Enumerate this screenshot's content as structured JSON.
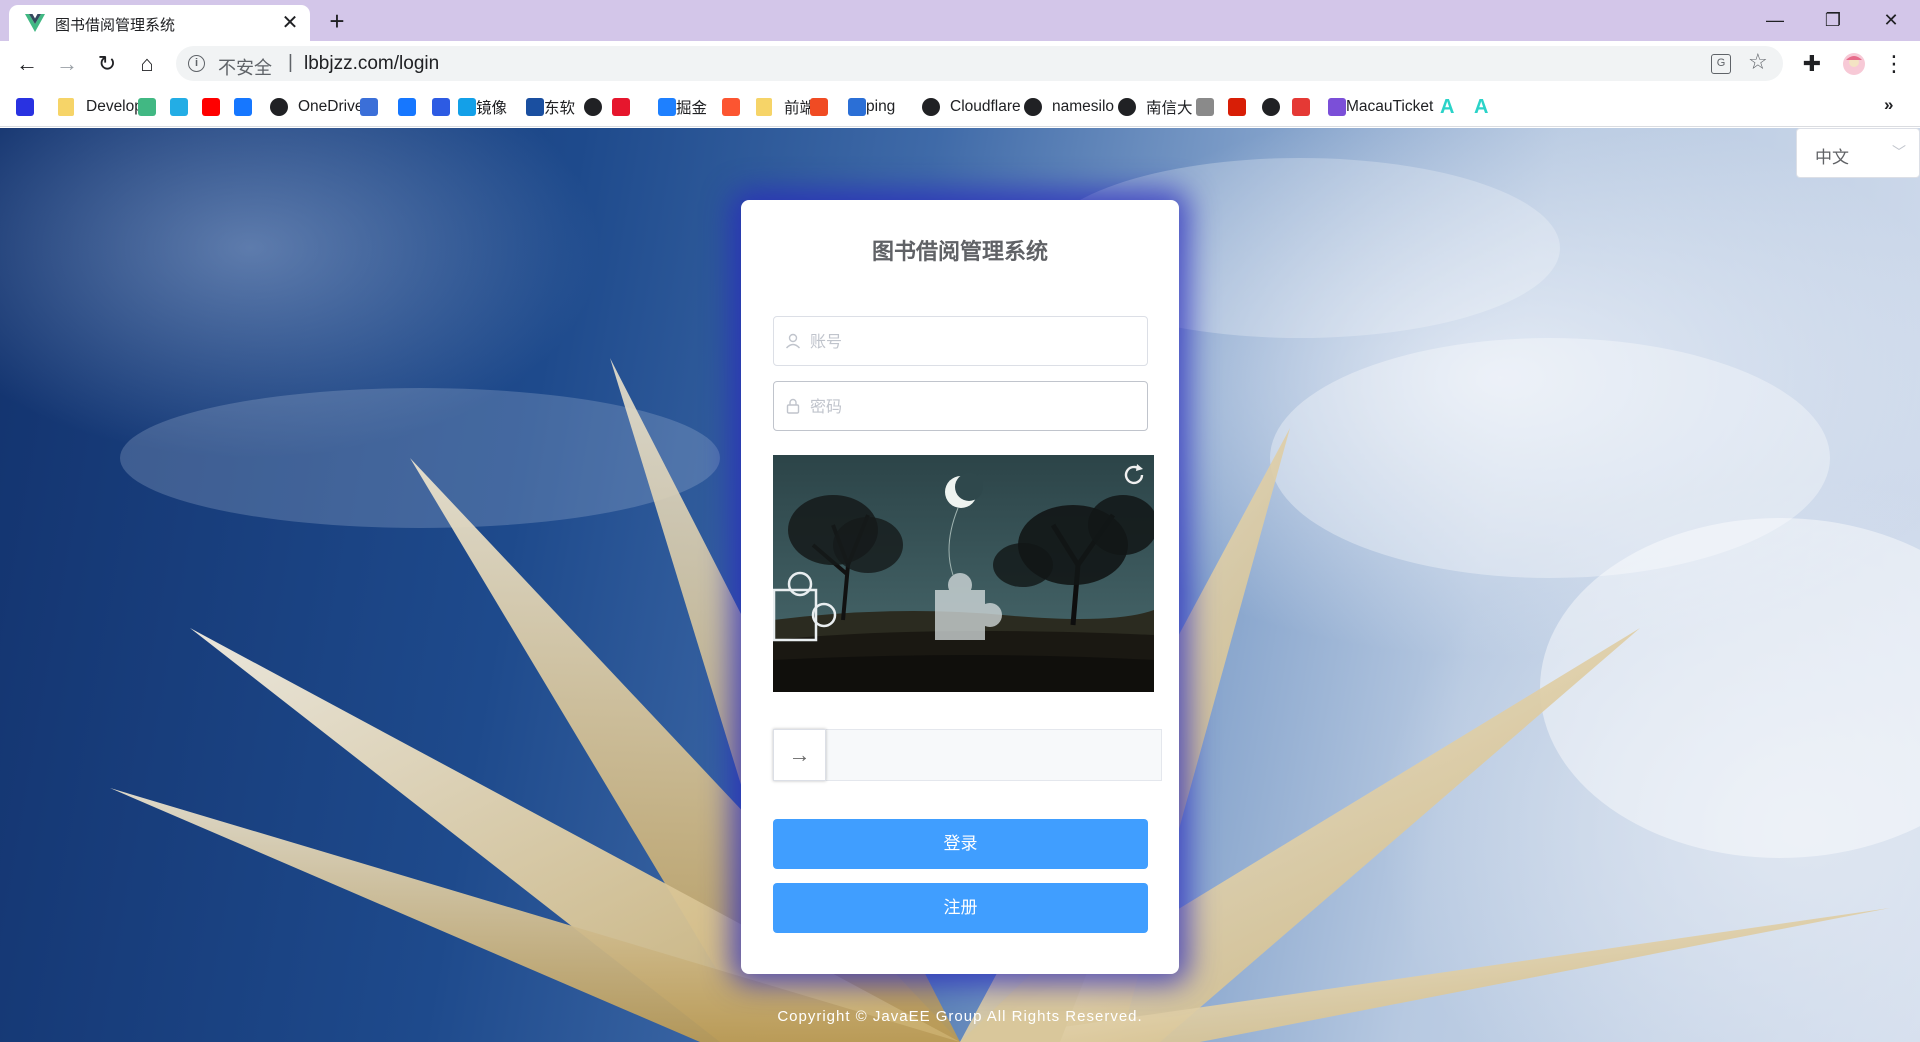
{
  "browser": {
    "tab_title": "图书借阅管理系统",
    "tab_close": "✕",
    "new_tab": "+",
    "window_controls": {
      "minimize": "—",
      "maximize": "❐",
      "close": "✕"
    }
  },
  "toolbar": {
    "back": "←",
    "forward": "→",
    "reload": "↻",
    "home": "⌂",
    "security_label": "不安全",
    "separator": "|",
    "url": "lbbjzz.com/login",
    "menu": "⋮",
    "extensions": "✚"
  },
  "bookmarks": [
    {
      "label": "",
      "icon": "baidu-paw",
      "color": "#2932e1"
    },
    {
      "label": "Develop",
      "icon": "folder",
      "color": "#f6d468"
    },
    {
      "label": "",
      "icon": "vue-v",
      "color": "#41b883"
    },
    {
      "label": "",
      "icon": "bilibili-tv",
      "color": "#23ade5"
    },
    {
      "label": "",
      "icon": "youtube-play",
      "color": "#ff0000"
    },
    {
      "label": "",
      "icon": "cloud-link",
      "color": "#1677ff"
    },
    {
      "label": "OneDrive",
      "icon": "globe",
      "color": "#202124"
    },
    {
      "label": "",
      "icon": "card",
      "color": "#3b6fd8"
    },
    {
      "label": "",
      "icon": "cloud",
      "color": "#1677ff"
    },
    {
      "label": "",
      "icon": "bowtie",
      "color": "#2d5be3"
    },
    {
      "label": "镜像",
      "icon": "bird",
      "color": "#13a0e8"
    },
    {
      "label": "东软",
      "icon": "dash",
      "color": "#1a4fa0"
    },
    {
      "label": "",
      "icon": "github",
      "color": "#202124"
    },
    {
      "label": "",
      "icon": "weibo-ring",
      "color": "#e6162d"
    },
    {
      "label": "掘金",
      "icon": "juejin",
      "color": "#1e80ff"
    },
    {
      "label": "",
      "icon": "csdn-c",
      "color": "#fc5531"
    },
    {
      "label": "前端",
      "icon": "folder",
      "color": "#f6d468"
    },
    {
      "label": "",
      "icon": "red-square",
      "color": "#f04b23"
    },
    {
      "label": "ping",
      "icon": "ping",
      "color": "#2b6fd6"
    },
    {
      "label": "Cloudflare",
      "icon": "globe",
      "color": "#202124"
    },
    {
      "label": "namesilo",
      "icon": "globe",
      "color": "#202124"
    },
    {
      "label": "南信大",
      "icon": "globe",
      "color": "#202124"
    },
    {
      "label": "",
      "icon": "apple",
      "color": "#8a8a8a"
    },
    {
      "label": "",
      "icon": "seal",
      "color": "#d81e06"
    },
    {
      "label": "",
      "icon": "globe",
      "color": "#202124"
    },
    {
      "label": "",
      "icon": "gauge",
      "color": "#e53935"
    },
    {
      "label": "MacauTicket",
      "icon": "ticket",
      "color": "#7b4fd8"
    },
    {
      "label": "A",
      "icon": "letter-a",
      "color": "#2bd3c8"
    },
    {
      "label": "A",
      "icon": "letter-a",
      "color": "#2bd3c8"
    }
  ],
  "bookmarks_more": "»",
  "page": {
    "language": {
      "selected": "中文"
    },
    "login": {
      "title": "图书借阅管理系统",
      "username_placeholder": "账号",
      "password_placeholder": "密码",
      "slider_arrow": "→",
      "login_button": "登录",
      "register_button": "注册"
    },
    "copyright": "Copyright © JavaEE Group All Rights Reserved."
  },
  "colors": {
    "tab_strip": "#d3c6e9",
    "primary_button": "#409eff",
    "card_glow": "#2828be"
  }
}
